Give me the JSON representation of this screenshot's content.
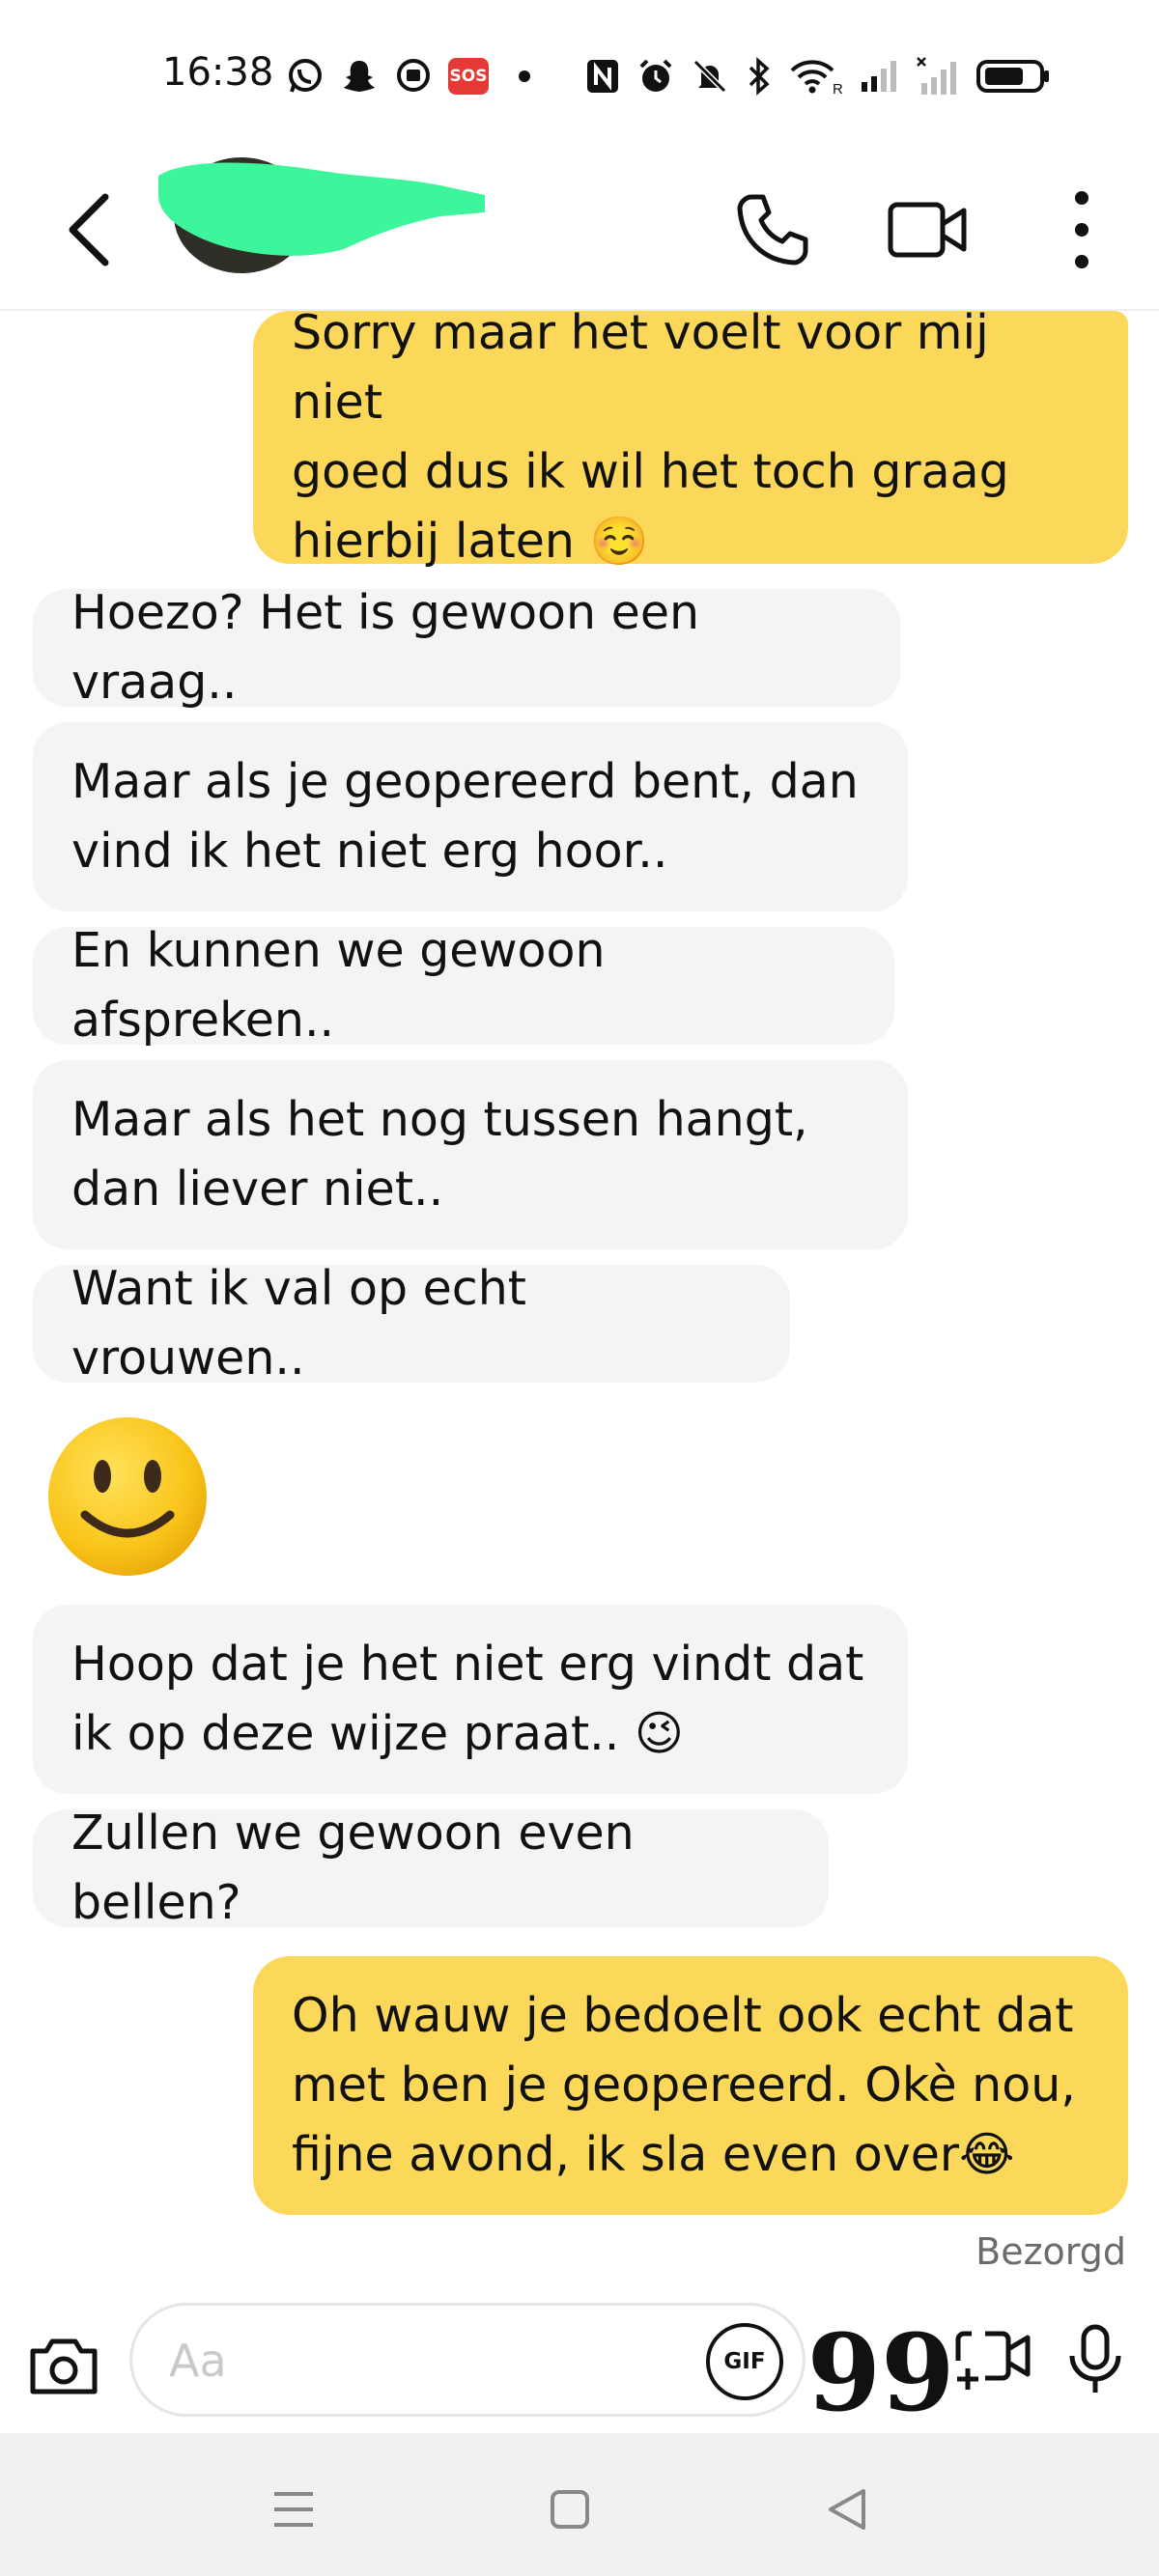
{
  "status_bar": {
    "time": "16:38",
    "sos_label": "SOS",
    "icons": [
      "whatsapp-icon",
      "snapchat-icon",
      "messenger-icon",
      "sos-icon",
      "dot-icon",
      "nfc-icon",
      "alarm-icon",
      "mute-icon",
      "bluetooth-icon",
      "wifi-icon",
      "signal-icon",
      "signal-icon",
      "battery-icon"
    ],
    "wifi_label": "R",
    "battery_level": 0.75
  },
  "header": {
    "contact_name_redacted": true,
    "redaction_color": "#3df59a"
  },
  "messages": [
    {
      "from": "me",
      "text": "Sorry maar het voelt voor mij niet\ngoed dus ik wil het toch graag\nhierbij laten ☺️"
    },
    {
      "from": "them",
      "text": "Hoezo? Het is gewoon een vraag.."
    },
    {
      "from": "them",
      "text": "Maar als je geopereerd bent, dan\nvind ik het niet erg hoor.."
    },
    {
      "from": "them",
      "text": "En kunnen we gewoon afspreken.."
    },
    {
      "from": "them",
      "text": "Maar als het nog tussen hangt,\ndan liever niet.."
    },
    {
      "from": "them",
      "text": "Want ik val op echt vrouwen.."
    },
    {
      "from": "them",
      "emoji": "🙂"
    },
    {
      "from": "them",
      "text": "Hoop dat je het niet erg vindt dat\nik op deze wijze praat.. 😉"
    },
    {
      "from": "them",
      "text": "Zullen we gewoon even bellen?"
    },
    {
      "from": "me",
      "text": "Oh wauw je bedoelt ook echt dat\nmet ben je geopereerd. Okè nou,\nfijne avond, ik sla even over😂"
    }
  ],
  "delivery_status": "Bezorgd",
  "composer": {
    "placeholder": "Aa",
    "gif_label": "GIF"
  },
  "colors": {
    "sent_bubble": "#fcd85a",
    "received_bubble": "#f4f4f4"
  }
}
